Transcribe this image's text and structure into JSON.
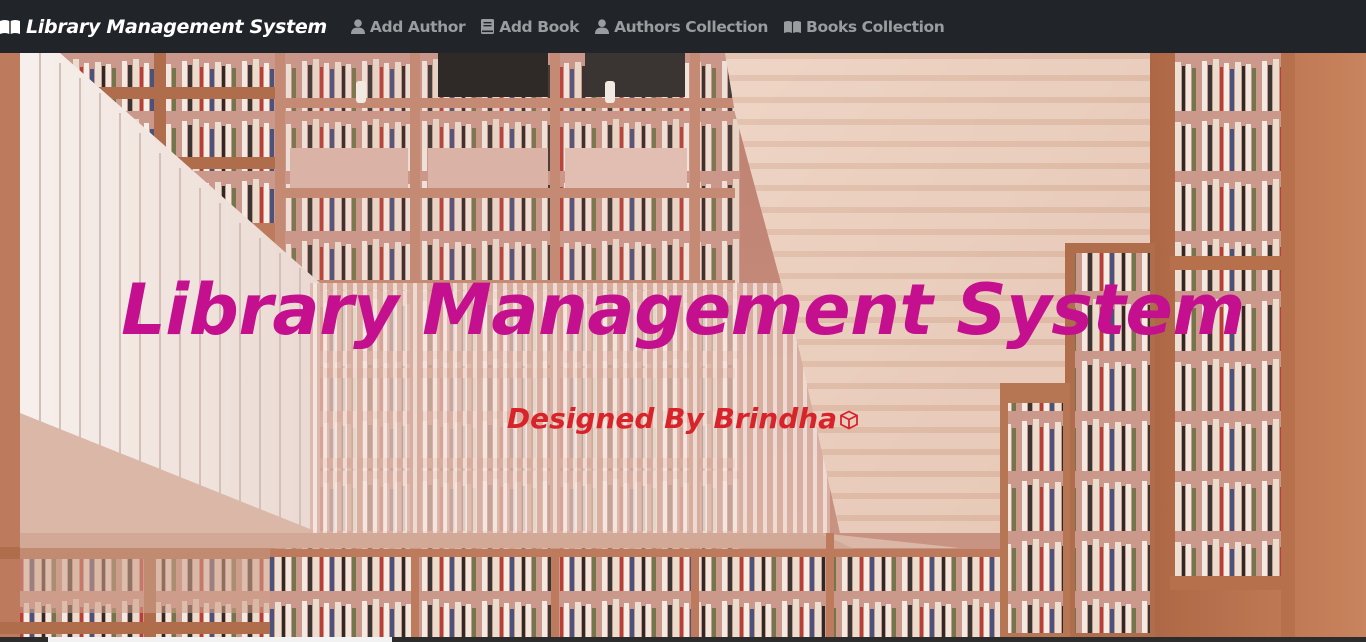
{
  "navbar": {
    "brand": {
      "label": "Library Management System",
      "icon": "book-open-icon"
    },
    "links": [
      {
        "label": "Add Author",
        "icon": "user-icon"
      },
      {
        "label": "Add Book",
        "icon": "book-icon"
      },
      {
        "label": "Authors Collection",
        "icon": "user-icon"
      },
      {
        "label": "Books Collection",
        "icon": "book-open-icon"
      }
    ]
  },
  "hero": {
    "title": "Library Management System",
    "subtitle": "Designed By Brindha",
    "subtitle_icon": "cube-icon",
    "background": "library-bookshelves-photo"
  },
  "colors": {
    "navbar_bg": "#212529",
    "brand_text": "#ffffff",
    "nav_text": "#9a9da0",
    "title": "#c4108e",
    "subtitle": "#d9232b"
  }
}
